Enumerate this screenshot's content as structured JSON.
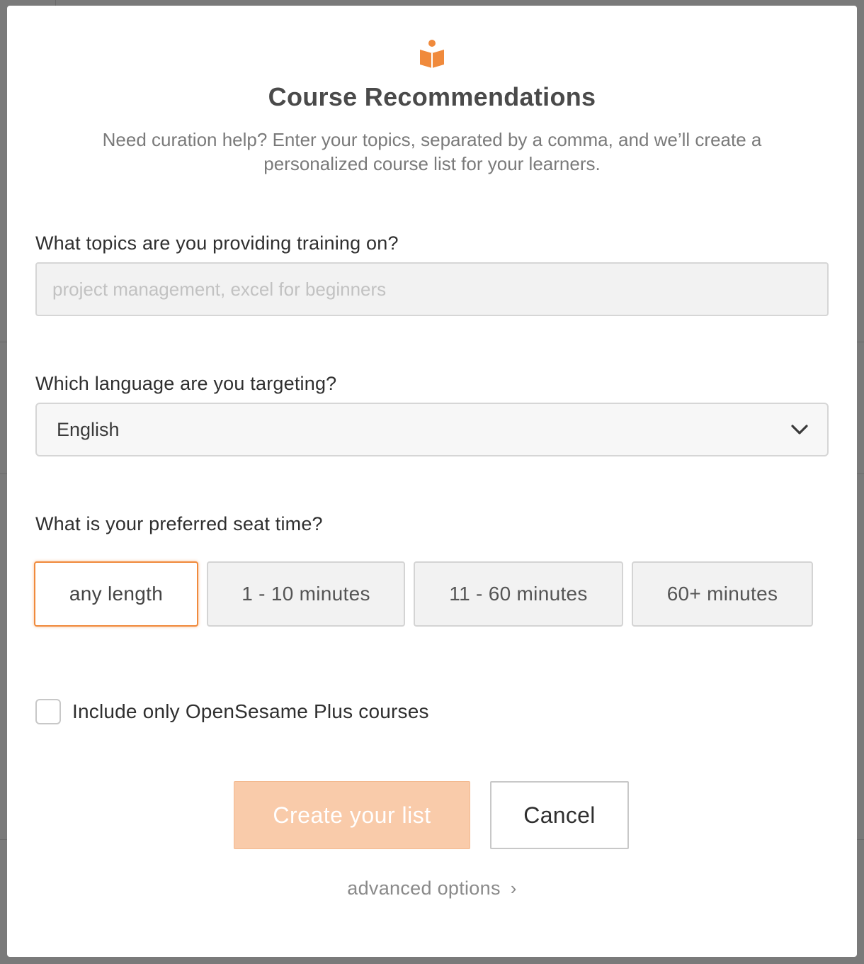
{
  "modal": {
    "title": "Course Recommendations",
    "subtitle": "Need curation help? Enter your topics, separated by a comma, and we’ll create a personalized course list for your learners.",
    "logo_icon": "book-reader-icon",
    "accent_color": "#f08a3c"
  },
  "topics": {
    "label": "What topics are you providing training on?",
    "value": "",
    "placeholder": "project management, excel for beginners"
  },
  "language": {
    "label": "Which language are you targeting?",
    "selected": "English",
    "icon": "chevron-down-icon"
  },
  "seat_time": {
    "label": "What is your preferred seat time?",
    "options": [
      "any length",
      "1 - 10 minutes",
      "11 - 60 minutes",
      "60+ minutes"
    ],
    "selected": "any length"
  },
  "plus_filter": {
    "label": "Include only OpenSesame Plus courses",
    "checked": false
  },
  "actions": {
    "create_label": "Create your list",
    "cancel_label": "Cancel"
  },
  "advanced": {
    "label": "advanced options",
    "arrow": "›"
  }
}
